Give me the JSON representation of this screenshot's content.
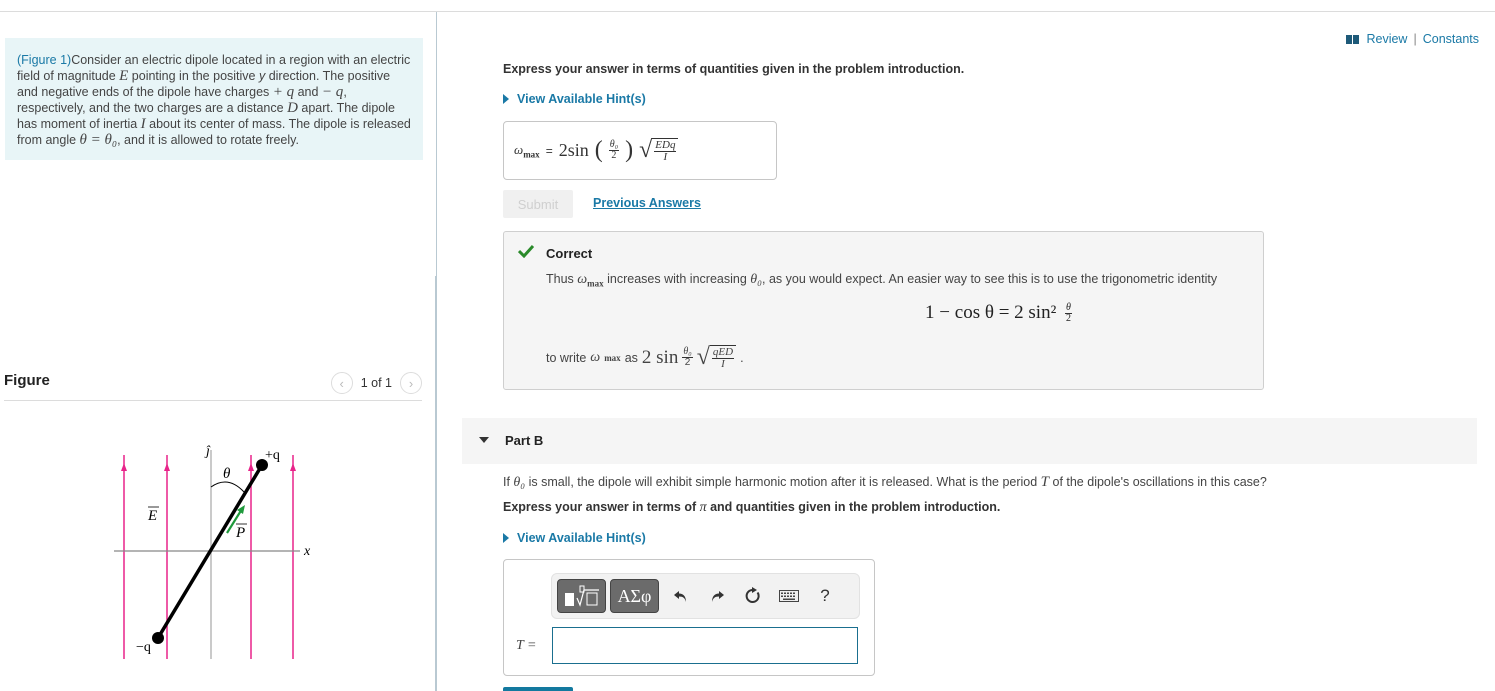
{
  "left_panel": {
    "intro": {
      "figure_link": "(Figure 1)",
      "text_parts": [
        "Consider an electric dipole located in a region with an electric field of magnitude ",
        "E",
        " pointing in the positive ",
        "y",
        " direction. The positive and negative ends of the dipole have charges ",
        "+ q",
        " and ",
        "− q",
        ", respectively, and the two charges are a distance ",
        "D",
        " apart. The dipole has moment of inertia ",
        "I",
        " about its center of mass. The dipole is released from angle ",
        "θ = θ₀",
        ", and it is allowed to rotate freely."
      ]
    },
    "figure_header": {
      "title": "Figure",
      "pager_text": "1 of 1",
      "prev_icon": "chevron-left-icon",
      "next_icon": "chevron-right-icon"
    },
    "figure": {
      "labels": {
        "j_hat": "ĵ",
        "plus_q": "+q",
        "minus_q": "−q",
        "theta": "θ",
        "E_vec": "E",
        "P_vec": "P",
        "x_axis": "x"
      },
      "colors": {
        "field_lines": "#e8248a",
        "dipole_vector": "#1f9a3c",
        "axes": "#b0b0b0",
        "dipole": "#000000"
      }
    }
  },
  "right_panel": {
    "review": {
      "review_label": "Review",
      "separator": "|",
      "constants_label": "Constants"
    },
    "part_a": {
      "express_text": "Express your answer in terms of quantities given in the problem introduction.",
      "hint_label": "View Available Hint(s)",
      "answer": {
        "lhs_symbol": "ω",
        "lhs_sub": "max",
        "equals": "=",
        "coef": "2sin",
        "frac_num": "θ₀",
        "frac_den": "2",
        "sqrt_num": "EDq",
        "sqrt_den": "I"
      },
      "submit_label": "Submit",
      "previous_answers_label": "Previous Answers",
      "feedback": {
        "status": "Correct",
        "line1_a": "Thus ",
        "omega": "ω",
        "omega_sub": "max",
        "line1_b": " increases with increasing ",
        "theta0": "θ₀",
        "line1_c": ", as you would expect. An easier way to see this is to use the trigonometric identity",
        "identity_lhs": "1 − cos θ = 2 sin²",
        "identity_frac_num": "θ",
        "identity_frac_den": "2",
        "line2_a": "to write ",
        "line2_b": " as ",
        "result_coef": "2 sin",
        "result_frac_num": "θ₀",
        "result_frac_den": "2",
        "result_sqrt_num": "qED",
        "result_sqrt_den": "I",
        "period": "."
      }
    },
    "part_b": {
      "title": "Part B",
      "question_a": "If ",
      "question_theta": "θ₀",
      "question_b": " is small, the dipole will exhibit simple harmonic motion after it is released. What is the period ",
      "question_T": "T",
      "question_c": " of the dipole's oscillations in this case?",
      "express_a": "Express your answer in terms of ",
      "express_pi": "π",
      "express_b": " and quantities given in the problem introduction.",
      "hint_label": "View Available Hint(s)",
      "toolbar": {
        "templates_label": "▮√□",
        "greek_label": "ΑΣφ",
        "undo": "↶",
        "redo": "↷",
        "reset": "↻",
        "keyboard": "⌨",
        "help": "?"
      },
      "input_label": "T =",
      "input_value": ""
    }
  }
}
